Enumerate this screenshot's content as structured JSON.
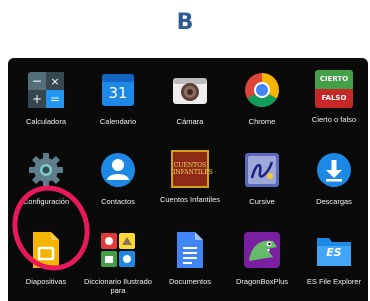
{
  "step_letter": "B",
  "apps": [
    {
      "label": "Calculadora",
      "icon": "calculator-icon"
    },
    {
      "label": "Calendario",
      "icon": "calendar-icon",
      "icon_text": "31"
    },
    {
      "label": "Cámara",
      "icon": "camera-icon"
    },
    {
      "label": "Chrome",
      "icon": "chrome-icon"
    },
    {
      "label": "Cierto o falso",
      "icon": "true-false-icon",
      "icon_text_top": "CIERTO",
      "icon_text_bottom": "FALSO"
    },
    {
      "label": "Configuración",
      "icon": "settings-gear-icon",
      "highlighted": true
    },
    {
      "label": "Contactos",
      "icon": "contacts-icon"
    },
    {
      "label": "Cuentos Infantiles",
      "icon": "childrens-stories-icon",
      "icon_text": "CUENTOS INFANTILES"
    },
    {
      "label": "Cursive",
      "icon": "cursive-icon"
    },
    {
      "label": "Descargas",
      "icon": "download-icon"
    },
    {
      "label": "Diapositivas",
      "icon": "slides-icon"
    },
    {
      "label": "Diccionario Ilustrado para",
      "icon": "illustrated-dictionary-icon"
    },
    {
      "label": "Documentos",
      "icon": "docs-icon"
    },
    {
      "label": "DragonBoxPlus",
      "icon": "dragonbox-icon"
    },
    {
      "label": "ES File Explorer",
      "icon": "file-explorer-icon",
      "icon_text": "ES"
    }
  ],
  "colors": {
    "highlight_ring": "#e8195a",
    "step_letter": "#2E5A96",
    "screen_background": "#0a0a0a"
  }
}
